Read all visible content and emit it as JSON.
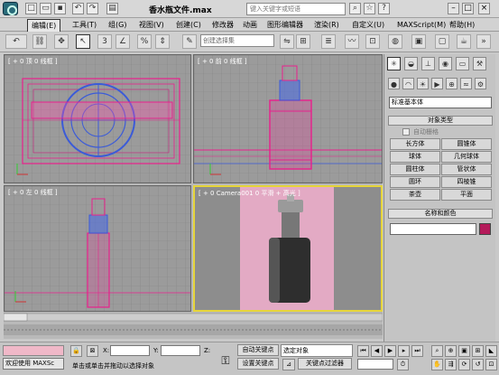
{
  "titlebar": {
    "title": "香水瓶文件.max",
    "search_placeholder": "键入关键字或短语"
  },
  "menu": [
    "编辑(E)",
    "工具(T)",
    "组(G)",
    "视图(V)",
    "创建(C)",
    "修改器",
    "动画",
    "图形编辑器",
    "渲染(R)",
    "自定义(U)",
    "MAXScript(M)",
    "帮助(H)"
  ],
  "toolbar": {
    "selection_set_placeholder": "创建选择集",
    "view_dropdown": "视图"
  },
  "viewports": {
    "top": "[ + 0 顶 0 线框 ]",
    "front": "[ + 0 前 0 线框 ]",
    "left": "[ + 0 左 0 线框 ]",
    "persp": "[ + 0 Camera001 0 平滑 + 高光 ]"
  },
  "command_panel": {
    "category_dropdown": "标准基本体",
    "object_type_title": "对象类型",
    "autogrid_label": "自动栅格",
    "object_buttons": [
      "长方体",
      "圆锥体",
      "球体",
      "几何球体",
      "圆柱体",
      "管状体",
      "圆环",
      "四棱锥",
      "茶壶",
      "平面"
    ],
    "name_color_title": "名称和颜色"
  },
  "status": {
    "welcome": "欢迎使用 MAXSc",
    "x_label": "X:",
    "y_label": "Y:",
    "z_label": "Z:",
    "prompt": "单击或单击并拖动以选择对象",
    "auto_key": "自动关键点",
    "set_key": "设置关键点",
    "selected_dropdown": "选定对象",
    "key_filters": "关键点过滤器"
  },
  "colors": {
    "accent_magenta": "#e8208c",
    "accent_blue": "#3b5bd8",
    "active_viewport_border": "#e6d53a",
    "grid": "#7f7f7f"
  }
}
